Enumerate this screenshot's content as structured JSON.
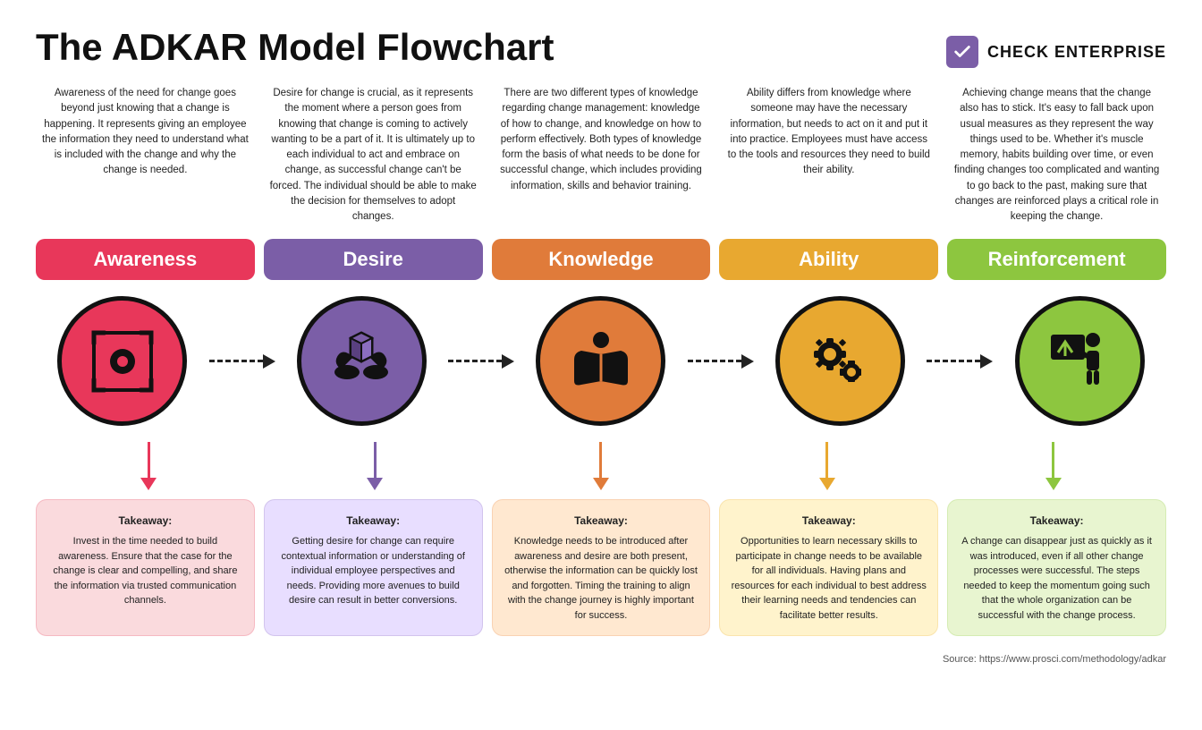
{
  "header": {
    "title": "The ADKAR Model Flowchart",
    "check_enterprise_label": "CHECK ENTERPRISE"
  },
  "columns": [
    {
      "id": "awareness",
      "label": "Awareness",
      "color": "#E8375A",
      "light_bg": "#FADADD",
      "top_desc": "Awareness of the need for change goes beyond just knowing that a change is happening. It represents giving an employee the information they need to understand what is included with the change and why the change is needed.",
      "takeaway_title": "Takeaway:",
      "takeaway_text": "Invest in the time needed to build awareness. Ensure that the case for the change is clear and compelling, and share the information via trusted communication channels."
    },
    {
      "id": "desire",
      "label": "Desire",
      "color": "#7B5EA7",
      "light_bg": "#E8DEFF",
      "top_desc": "Desire for change is crucial, as it represents the moment where a person goes from knowing that change is coming to actively wanting to be a part of it. It is ultimately up to each individual to act and embrace on change, as successful change can't be forced. The individual should be able to make the decision for themselves to adopt changes.",
      "takeaway_title": "Takeaway:",
      "takeaway_text": "Getting desire for change can require contextual information or understanding of individual employee perspectives and needs. Providing more avenues to build desire can result in better conversions."
    },
    {
      "id": "knowledge",
      "label": "Knowledge",
      "color": "#E07B3A",
      "light_bg": "#FFE8D0",
      "top_desc": "There are two different types of knowledge regarding change management: knowledge of how to change, and knowledge on how to perform effectively. Both types of knowledge form the basis of what needs to be done for successful change, which includes providing information, skills and behavior training.",
      "takeaway_title": "Takeaway:",
      "takeaway_text": "Knowledge needs to be introduced after awareness and desire are both present, otherwise the information can be quickly lost and forgotten. Timing the training to align with the change journey is highly important for success."
    },
    {
      "id": "ability",
      "label": "Ability",
      "color": "#E8A830",
      "light_bg": "#FFF3CC",
      "top_desc": "Ability differs from knowledge where someone may have the necessary information, but needs to act on it and put it into practice. Employees must have access to the tools and resources they need to build their ability.",
      "takeaway_title": "Takeaway:",
      "takeaway_text": "Opportunities to learn necessary skills to participate in change needs to be available for all individuals. Having plans and resources for each individual to best address their learning needs and tendencies can facilitate better results."
    },
    {
      "id": "reinforcement",
      "label": "Reinforcement",
      "color": "#8DC63F",
      "light_bg": "#E8F5D0",
      "top_desc": "Achieving change means that the change also has to stick. It's easy to fall back upon usual measures as they represent the way things used to be. Whether it's muscle memory, habits building over time, or even finding changes too complicated and wanting to go back to the past, making sure that changes are reinforced plays a critical role in keeping the change.",
      "takeaway_title": "Takeaway:",
      "takeaway_text": "A change can disappear just as quickly as it was introduced, even if all other change processes were successful. The steps needed to keep the momentum going such that the whole organization can be successful with the change process."
    }
  ],
  "source": "Source: https://www.prosci.com/methodology/adkar"
}
